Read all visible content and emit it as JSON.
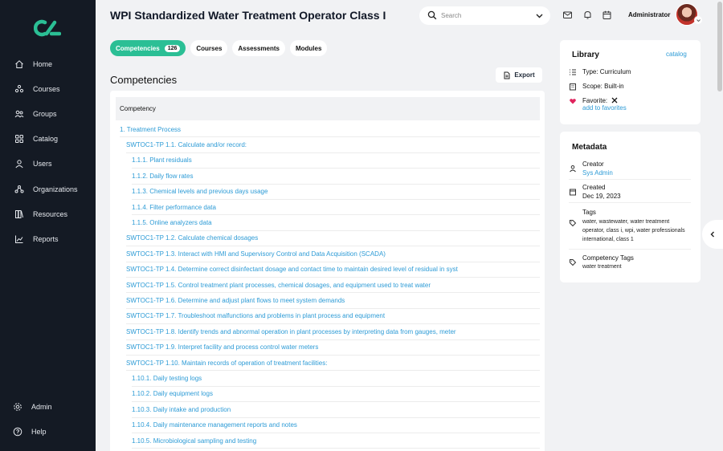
{
  "sidebar": {
    "logo_icon": "brand-logo-icon",
    "items": [
      {
        "label": "Home",
        "icon": "home-icon"
      },
      {
        "label": "Courses",
        "icon": "courses-icon"
      },
      {
        "label": "Groups",
        "icon": "groups-icon"
      },
      {
        "label": "Catalog",
        "icon": "catalog-icon"
      },
      {
        "label": "Users",
        "icon": "user-icon"
      },
      {
        "label": "Organizations",
        "icon": "organizations-icon"
      },
      {
        "label": "Resources",
        "icon": "resources-icon"
      },
      {
        "label": "Reports",
        "icon": "reports-icon"
      }
    ],
    "bottom": [
      {
        "label": "Admin",
        "icon": "gear-icon"
      },
      {
        "label": "Help",
        "icon": "help-icon"
      }
    ]
  },
  "header": {
    "title": "WPI Standardized Water Treatment Operator Class I",
    "search_placeholder": "Search",
    "user_name": "Administrator"
  },
  "tabs": [
    {
      "label": "Competencies",
      "count": "126",
      "active": true
    },
    {
      "label": "Courses"
    },
    {
      "label": "Assessments"
    },
    {
      "label": "Modules"
    }
  ],
  "main": {
    "section_title": "Competencies",
    "export_label": "Export",
    "column_header": "Competency",
    "rows": [
      {
        "text": "1. Treatment Process",
        "level": 0
      },
      {
        "text": "SWTOC1-TP 1.1. Calculate and/or record:",
        "level": 1
      },
      {
        "text": "1.1.1. Plant residuals",
        "level": 2
      },
      {
        "text": "1.1.2. Daily flow rates",
        "level": 2
      },
      {
        "text": "1.1.3. Chemical levels and previous days usage",
        "level": 2
      },
      {
        "text": "1.1.4. Filter performance data",
        "level": 2
      },
      {
        "text": "1.1.5. Online analyzers data",
        "level": 2
      },
      {
        "text": "SWTOC1-TP 1.2. Calculate chemical dosages",
        "level": 1
      },
      {
        "text": "SWTOC1-TP 1.3. Interact with HMI and Supervisory Control and Data Acquisition (SCADA)",
        "level": 1
      },
      {
        "text": "SWTOC1-TP 1.4. Determine correct disinfectant dosage and contact time to maintain desired level of residual in syst",
        "level": 1
      },
      {
        "text": "SWTOC1-TP 1.5. Control treatment plant processes, chemical dosages, and equipment used to treat water",
        "level": 1
      },
      {
        "text": "SWTOC1-TP 1.6. Determine and adjust plant flows to meet system demands",
        "level": 1
      },
      {
        "text": "SWTOC1-TP 1.7. Troubleshoot malfunctions and problems in plant process and equipment",
        "level": 1
      },
      {
        "text": "SWTOC1-TP 1.8. Identify trends and abnormal operation in plant processes by interpreting data from gauges, meter",
        "level": 1
      },
      {
        "text": "SWTOC1-TP 1.9. Interpret facility and process control water meters",
        "level": 1
      },
      {
        "text": "SWTOC1-TP 1.10. Maintain records of operation of treatment facilities:",
        "level": 1
      },
      {
        "text": "1.10.1. Daily testing logs",
        "level": 2
      },
      {
        "text": "1.10.2. Daily equipment logs",
        "level": 2
      },
      {
        "text": "1.10.3. Daily intake and production",
        "level": 2
      },
      {
        "text": "1.10.4. Daily maintenance management reports and notes",
        "level": 2
      },
      {
        "text": "1.10.5. Microbiological sampling and testing",
        "level": 2
      }
    ]
  },
  "library": {
    "title": "Library",
    "link": "catalog",
    "type": "Type: Curriculum",
    "scope": "Scope: Built-in",
    "favorite_label": "Favorite:",
    "favorite_action": "add to favorites"
  },
  "metadata": {
    "title": "Metadata",
    "creator_label": "Creator",
    "creator_value": "Sys Admin",
    "created_label": "Created",
    "created_value": "Dec 19, 2023",
    "tags_label": "Tags",
    "tags_value": "water, wastewater, water treatment operator, class i, wpi, water professionals international, class 1",
    "comp_tags_label": "Competency Tags",
    "comp_tags_value": "water treatment"
  },
  "colors": {
    "accent": "#2bbf95",
    "link": "#2d9bd6",
    "sidebar_bg": "#141a24",
    "favorite": "#e0245e"
  }
}
